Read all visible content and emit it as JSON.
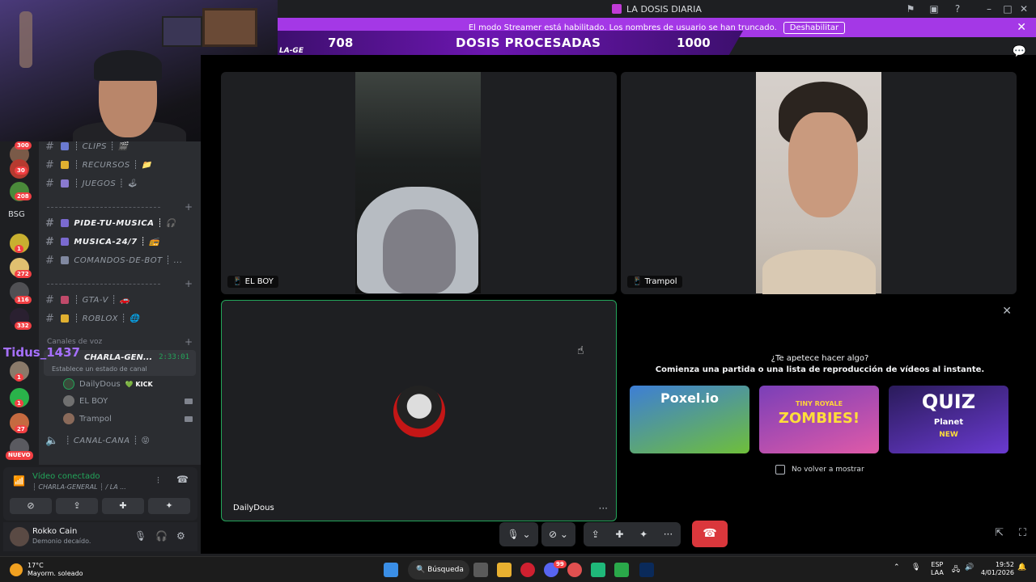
{
  "window": {
    "title": "LA DOSIS DIARIA"
  },
  "streamer_banner": {
    "message": "El modo Streamer está habilitado. Los nombres de usuario se han truncado.",
    "disable_label": "Deshabilitar"
  },
  "overlay": {
    "left_value": "708",
    "title": "DOSIS PROCESADAS",
    "right_value": "1000",
    "channel_fragment": "LA-GE"
  },
  "servers": {
    "badges": [
      "300",
      "30",
      "208",
      "1",
      "272",
      "116",
      "332",
      "1",
      "1",
      "27"
    ],
    "bsg_label": "BSG",
    "new_label": "NUEVO"
  },
  "channels": {
    "text": [
      {
        "name": "┊ CLIPS ┊ 🎬",
        "bold": false
      },
      {
        "name": "┊ RECURSOS ┊ 📁",
        "bold": false
      },
      {
        "name": "┊ JUEGOS ┊ 🕹",
        "bold": false
      }
    ],
    "music": [
      {
        "name": "PIDE-TU-MUSICA ┊ 🎧",
        "bold": true
      },
      {
        "name": "MUSICA-24/7 ┊ 📻",
        "bold": true
      },
      {
        "name": "COMANDOS-DE-BOT ┊ ...",
        "bold": false
      }
    ],
    "games": [
      {
        "name": "┊ GTA-V ┊ 🚗",
        "bold": false
      },
      {
        "name": "┊ ROBLOX ┊ 🌐",
        "bold": false
      }
    ],
    "voice_category": "Canales de voz",
    "active_voice": {
      "name": "CHARLA-GEN...",
      "time": "2:33:01",
      "status_placeholder": "Establece un estado de canal"
    },
    "streamer_overlay_name": "Tidus_1437",
    "members": [
      {
        "name": "DailyDous",
        "badge": "💚 KICK",
        "camera": false
      },
      {
        "name": "EL BOY",
        "badge": "",
        "camera": true
      },
      {
        "name": "Trampol",
        "badge": "",
        "camera": true
      }
    ],
    "other_voice": "┊ CANAL-CANA ┊ 😝"
  },
  "voice_panel": {
    "status": "Vídeo conectado",
    "location": "┊ CHARLA-GENERAL ┊ / LA ..."
  },
  "user": {
    "name": "Rokko Cain",
    "status": "Demonio decaído."
  },
  "tiles": [
    {
      "name": "EL BOY"
    },
    {
      "name": "Trampol"
    },
    {
      "name": "DailyDous"
    }
  ],
  "activity": {
    "heading": "¿Te apetece hacer algo?",
    "subheading": "Comienza una partida o una lista de reproducción de vídeos al instante.",
    "games": [
      {
        "title": "Poxel.io",
        "colors": [
          "#3d7ed6",
          "#6fbf3a"
        ]
      },
      {
        "title": "ZOMBIES!",
        "sub": "TINY ROYALE",
        "colors": [
          "#7a3fb8",
          "#e05aa8"
        ]
      },
      {
        "title": "QUIZ",
        "sub": "Planet",
        "tag": "NEW",
        "colors": [
          "#2a1b5a",
          "#6a3ad0"
        ]
      }
    ],
    "dont_show_label": "No volver a mostrar"
  },
  "taskbar": {
    "temperature": "17°C",
    "weather": "Mayorm. soleado",
    "search_label": "Búsqueda",
    "lang_line1": "ESP",
    "lang_line2": "LAA",
    "time": "19:52",
    "date": "4/01/2026",
    "notif_badge": "99"
  },
  "icons": {
    "accent": "#a438e6",
    "online": "#23a55a",
    "danger": "#da373c"
  }
}
